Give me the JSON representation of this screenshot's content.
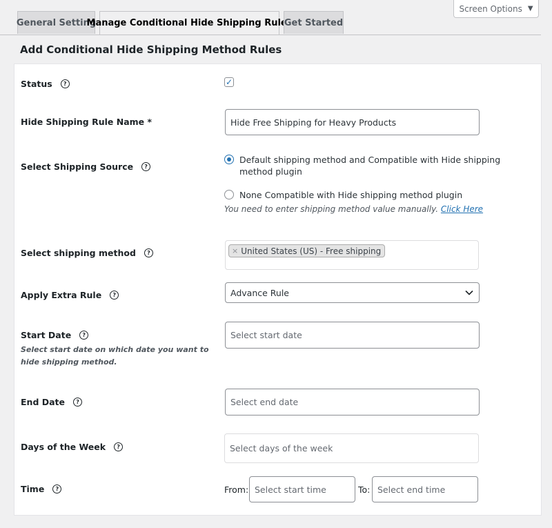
{
  "screen_options": {
    "label": "Screen Options"
  },
  "tabs": [
    {
      "label": "General Setting",
      "active": false
    },
    {
      "label": "Manage Conditional Hide Shipping Rules",
      "active": true
    },
    {
      "label": "Get Started",
      "active": false
    }
  ],
  "page_title": "Add Conditional Hide Shipping Method Rules",
  "form": {
    "status": {
      "label": "Status",
      "checked": true
    },
    "rule_name": {
      "label": "Hide Shipping Rule Name *",
      "value": "Hide Free Shipping for Heavy Products"
    },
    "shipping_source": {
      "label": "Select Shipping Source",
      "option1": "Default shipping method and Compatible with Hide shipping method plugin",
      "option2": "None Compatible with Hide shipping method plugin",
      "selected": "option1",
      "note": "You need to enter shipping method value manually.",
      "note_link": "Click Here"
    },
    "shipping_method": {
      "label": "Select shipping method",
      "tag_remove": "×",
      "tag": "United States (US) - Free shipping"
    },
    "extra_rule": {
      "label": "Apply Extra Rule",
      "value": "Advance Rule"
    },
    "start_date": {
      "label": "Start Date",
      "description": "Select start date on which date you want to hide shipping method.",
      "placeholder": "Select start date"
    },
    "end_date": {
      "label": "End Date",
      "placeholder": "Select end date"
    },
    "days": {
      "label": "Days of the Week",
      "placeholder": "Select days of the week"
    },
    "time": {
      "label": "Time",
      "from_label": "From:",
      "from_placeholder": "Select start time",
      "to_label": "To:",
      "to_placeholder": "Select end time"
    }
  },
  "icons": {
    "help": "help-circle-icon",
    "checkmark": "checkmark-icon",
    "chevron": "chevron-down-icon",
    "caret": "caret-down-icon"
  },
  "colors": {
    "accent": "#2271b1",
    "page_bg": "#f0f0f1",
    "panel_bg": "#ffffff"
  }
}
